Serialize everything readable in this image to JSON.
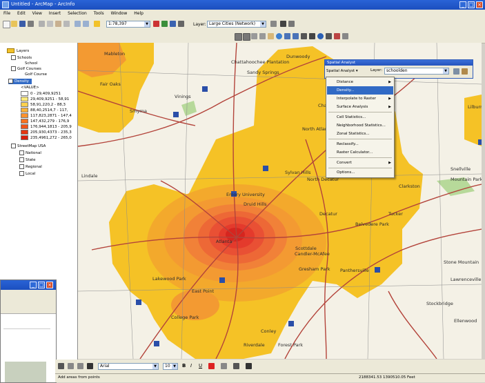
{
  "window": {
    "title": "Untitled - ArcMap - ArcInfo"
  },
  "menu": [
    "File",
    "Edit",
    "View",
    "Insert",
    "Selection",
    "Tools",
    "Window",
    "Help"
  ],
  "toolbar": {
    "scale": "1:78,397",
    "layer_label": "Layer:",
    "layer_value": "Large Cities (Network)"
  },
  "toc": {
    "root": "Layers",
    "items": [
      {
        "label": "Schools"
      },
      {
        "label": "School"
      },
      {
        "label": "Golf Courses"
      },
      {
        "label": "Golf Course"
      },
      {
        "label": "Density"
      },
      {
        "label": "<VALUE>"
      },
      {
        "label": "0 - 29,409,9251"
      },
      {
        "label": "29,409,9251 - 58,91"
      },
      {
        "label": "58,91,220,2 - 88,3"
      },
      {
        "label": "88,40,2514,7 - 117,"
      },
      {
        "label": "117,823,2871 - 147,4"
      },
      {
        "label": "147,432,279 - 176,9"
      },
      {
        "label": "176,944,1813 - 205,9"
      },
      {
        "label": "205,930,4373 - 235,3"
      },
      {
        "label": "235,4961,272 - 265,0"
      },
      {
        "label": "StreetMap USA"
      },
      {
        "label": "National"
      },
      {
        "label": "State"
      },
      {
        "label": "Regional"
      },
      {
        "label": "Local"
      }
    ]
  },
  "density_colors": [
    "#ffffff",
    "#ffe97a",
    "#ffd24d",
    "#ffb33a",
    "#ff922c",
    "#f8721f",
    "#f05418",
    "#e53712",
    "#d81e0c"
  ],
  "spatial_analyst": {
    "title": "Spatial Analyst",
    "dropdown": "Spatial Analyst",
    "layer_label": "Layer:",
    "layer_value": "schoolden",
    "menu": [
      {
        "label": "Distance",
        "sub": true
      },
      {
        "label": "Density...",
        "highlighted": true
      },
      {
        "label": "Interpolate to Raster",
        "sub": true
      },
      {
        "label": "Surface Analysis",
        "sub": true
      },
      {
        "label": "Cell Statistics..."
      },
      {
        "label": "Neighborhood Statistics..."
      },
      {
        "label": "Zonal Statistics..."
      },
      {
        "label": "Reclassify..."
      },
      {
        "label": "Raster Calculator..."
      },
      {
        "label": "Convert",
        "sub": true
      },
      {
        "label": "Options..."
      }
    ]
  },
  "map_labels": [
    "Dunwoody",
    "Chattahoochee Plantation",
    "Sandy Springs",
    "Fair Oaks",
    "Smyrna",
    "Mableton",
    "Chamblee",
    "North Atlanta",
    "Lilburn",
    "Lindale",
    "Mountain Park",
    "Sylvan Hills",
    "Druid Hills",
    "Emory University",
    "North Decatur",
    "Belvedere Park",
    "Decatur",
    "Candler-McAfee",
    "Lakewood Park",
    "East Point",
    "College Park",
    "Riverdale",
    "Clarkston",
    "Ellenwood",
    "Stockbridge",
    "Forest Park",
    "Conley",
    "Panthersville",
    "Gresham Park",
    "Tucker",
    "Snellville",
    "Stone Mountain",
    "Vinings",
    "Lawrenceville Ridge",
    "Scottdale",
    "Atlanta"
  ],
  "statusbar": {
    "left": "Add areas from points",
    "right": "2188341.53  1390510.05 Feet"
  },
  "drawing": {
    "font": "Arial",
    "size": "10"
  }
}
